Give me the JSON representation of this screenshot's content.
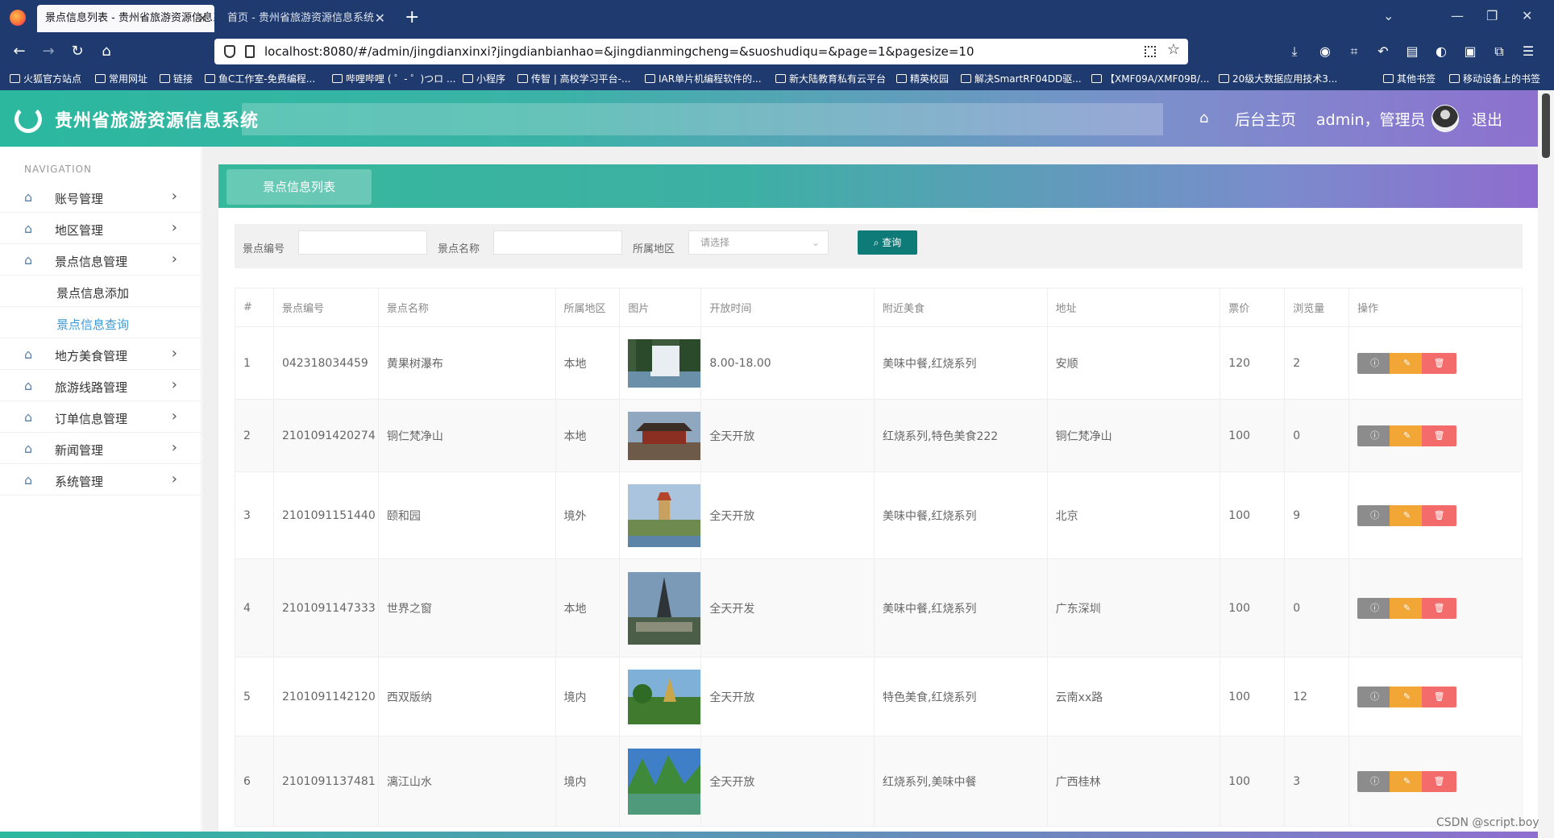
{
  "browser": {
    "tabs": [
      {
        "title": "景点信息列表 - 贵州省旅游资源信息系统",
        "active": true
      },
      {
        "title": "首页 - 贵州省旅游资源信息系统",
        "active": false
      }
    ],
    "url": "localhost:8080/#/admin/jingdianxinxi?jingdianbianhao=&jingdianmingcheng=&suoshudiqu=&page=1&pagesize=10",
    "bookmarks": [
      "火狐官方站点",
      "常用网址",
      "链接",
      "鱼C工作室-免费编程...",
      "哔哩哔哩 ( ゜- ゜)つロ ...",
      "小程序",
      "传智 | 高校学习平台-...",
      "IAR单片机编程软件的...",
      "新大陆教育私有云平台",
      "精英校园",
      "解决SmartRF04DD驱...",
      "【XMF09A/XMF09B/...",
      "20级大数据应用技术3...",
      "其他书签",
      "移动设备上的书签"
    ]
  },
  "header": {
    "title": "贵州省旅游资源信息系统",
    "home_link": "后台主页",
    "user": "admin，管理员",
    "logout": "退出"
  },
  "sidebar": {
    "caption": "NAVIGATION",
    "items": [
      {
        "label": "账号管理"
      },
      {
        "label": "地区管理"
      },
      {
        "label": "景点信息管理"
      },
      {
        "label": "景点信息添加"
      },
      {
        "label": "景点信息查询"
      },
      {
        "label": "地方美食管理"
      },
      {
        "label": "旅游线路管理"
      },
      {
        "label": "订单信息管理"
      },
      {
        "label": "新闻管理"
      },
      {
        "label": "系统管理"
      }
    ]
  },
  "panel": {
    "tab_label": "景点信息列表"
  },
  "search": {
    "code_label": "景点编号",
    "name_label": "景点名称",
    "region_label": "所属地区",
    "region_placeholder": "请选择",
    "button": "查询"
  },
  "table": {
    "headers": [
      "#",
      "景点编号",
      "景点名称",
      "所属地区",
      "图片",
      "开放时间",
      "附近美食",
      "地址",
      "票价",
      "浏览量",
      "操作"
    ],
    "rows": [
      {
        "no": "1",
        "code": "042318034459",
        "name": "黄果树瀑布",
        "region": "本地",
        "hours": "8.00-18.00",
        "food": "美味中餐,红烧系列",
        "address": "安顺",
        "price": "120",
        "views": "2"
      },
      {
        "no": "2",
        "code": "2101091420274",
        "name": "铜仁梵净山",
        "region": "本地",
        "hours": "全天开放",
        "food": "红烧系列,特色美食222",
        "address": "铜仁梵净山",
        "price": "100",
        "views": "0"
      },
      {
        "no": "3",
        "code": "2101091151440",
        "name": "颐和园",
        "region": "境外",
        "hours": "全天开放",
        "food": "美味中餐,红烧系列",
        "address": "北京",
        "price": "100",
        "views": "9"
      },
      {
        "no": "4",
        "code": "2101091147333",
        "name": "世界之窗",
        "region": "本地",
        "hours": "全天开发",
        "food": "美味中餐,红烧系列",
        "address": "广东深圳",
        "price": "100",
        "views": "0"
      },
      {
        "no": "5",
        "code": "2101091142120",
        "name": "西双版纳",
        "region": "境内",
        "hours": "全天开放",
        "food": "特色美食,红烧系列",
        "address": "云南xx路",
        "price": "100",
        "views": "12"
      },
      {
        "no": "6",
        "code": "2101091137481",
        "name": "漓江山水",
        "region": "境内",
        "hours": "全天开放",
        "food": "红烧系列,美味中餐",
        "address": "广西桂林",
        "price": "100",
        "views": "3"
      }
    ]
  },
  "watermark": "CSDN @script.boy",
  "colors": {
    "accent_green": "#2bb89f",
    "accent_purple": "#8e6fcf",
    "query_button": "#0f7b78",
    "edit_button": "#f1a635",
    "delete_button": "#f36b6b"
  }
}
